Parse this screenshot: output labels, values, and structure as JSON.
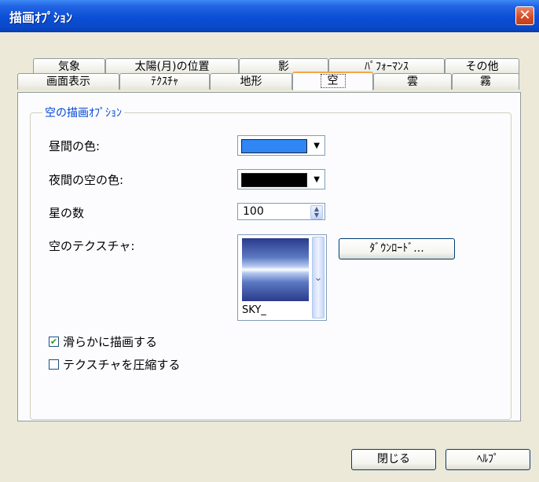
{
  "window": {
    "title": "描画ｵﾌﾟｼｮﾝ",
    "close_glyph": "✕"
  },
  "tabs_back": [
    "気象",
    "太陽(月)の位置",
    "影",
    "ﾊﾟﾌｫｰﾏﾝｽ",
    "その他"
  ],
  "tabs_front": [
    "画面表示",
    "ﾃｸｽﾁｬ",
    "地形",
    "空",
    "雲",
    "霧"
  ],
  "group": {
    "title": "空の描画ｵﾌﾟｼｮﾝ"
  },
  "fields": {
    "day_color_label": "昼間の色:",
    "day_color": "#2f86f5",
    "night_color_label": "夜間の空の色:",
    "night_color": "#000000",
    "stars_label": "星の数",
    "stars_value": "100",
    "texture_label": "空のテクスチャ:",
    "texture_name": "SKY_",
    "download_label": "ﾀﾞｳﾝﾛｰﾄﾞ..."
  },
  "checkboxes": {
    "smooth": {
      "label": "滑らかに描画する",
      "checked": true
    },
    "compress": {
      "label": "テクスチャを圧縮する",
      "checked": false
    }
  },
  "buttons": {
    "close": "閉じる",
    "help": "ﾍﾙﾌﾟ"
  },
  "icons": {
    "dropdown": "▼",
    "spin_up": "▲",
    "spin_down": "▼",
    "chevron": "⌄",
    "check": "✔"
  }
}
